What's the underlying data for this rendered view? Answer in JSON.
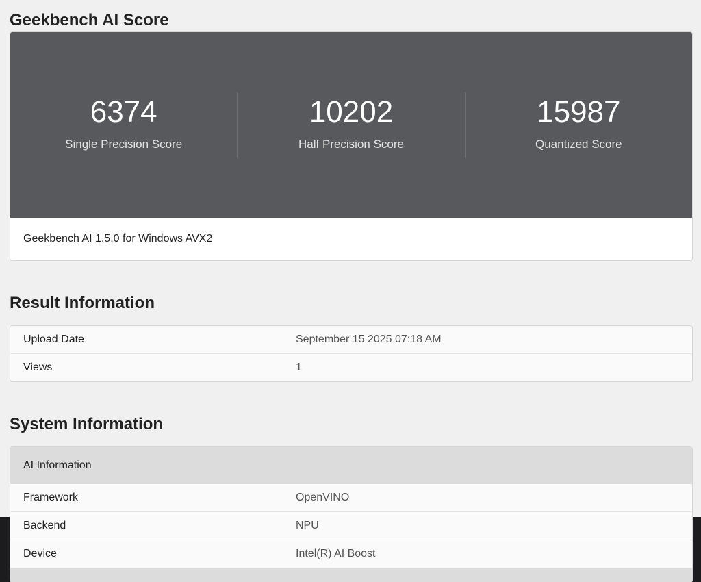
{
  "score_section": {
    "title": "Geekbench AI Score",
    "scores": [
      {
        "value": "6374",
        "label": "Single Precision Score"
      },
      {
        "value": "10202",
        "label": "Half Precision Score"
      },
      {
        "value": "15987",
        "label": "Quantized Score"
      }
    ],
    "version": "Geekbench AI 1.5.0 for Windows AVX2"
  },
  "result_info": {
    "title": "Result Information",
    "rows": [
      {
        "key": "Upload Date",
        "value": "September 15 2025 07:18 AM"
      },
      {
        "key": "Views",
        "value": "1"
      }
    ]
  },
  "system_info": {
    "title": "System Information",
    "group": "AI Information",
    "rows": [
      {
        "key": "Framework",
        "value": "OpenVINO"
      },
      {
        "key": "Backend",
        "value": "NPU"
      },
      {
        "key": "Device",
        "value": "Intel(R) AI Boost"
      }
    ]
  }
}
